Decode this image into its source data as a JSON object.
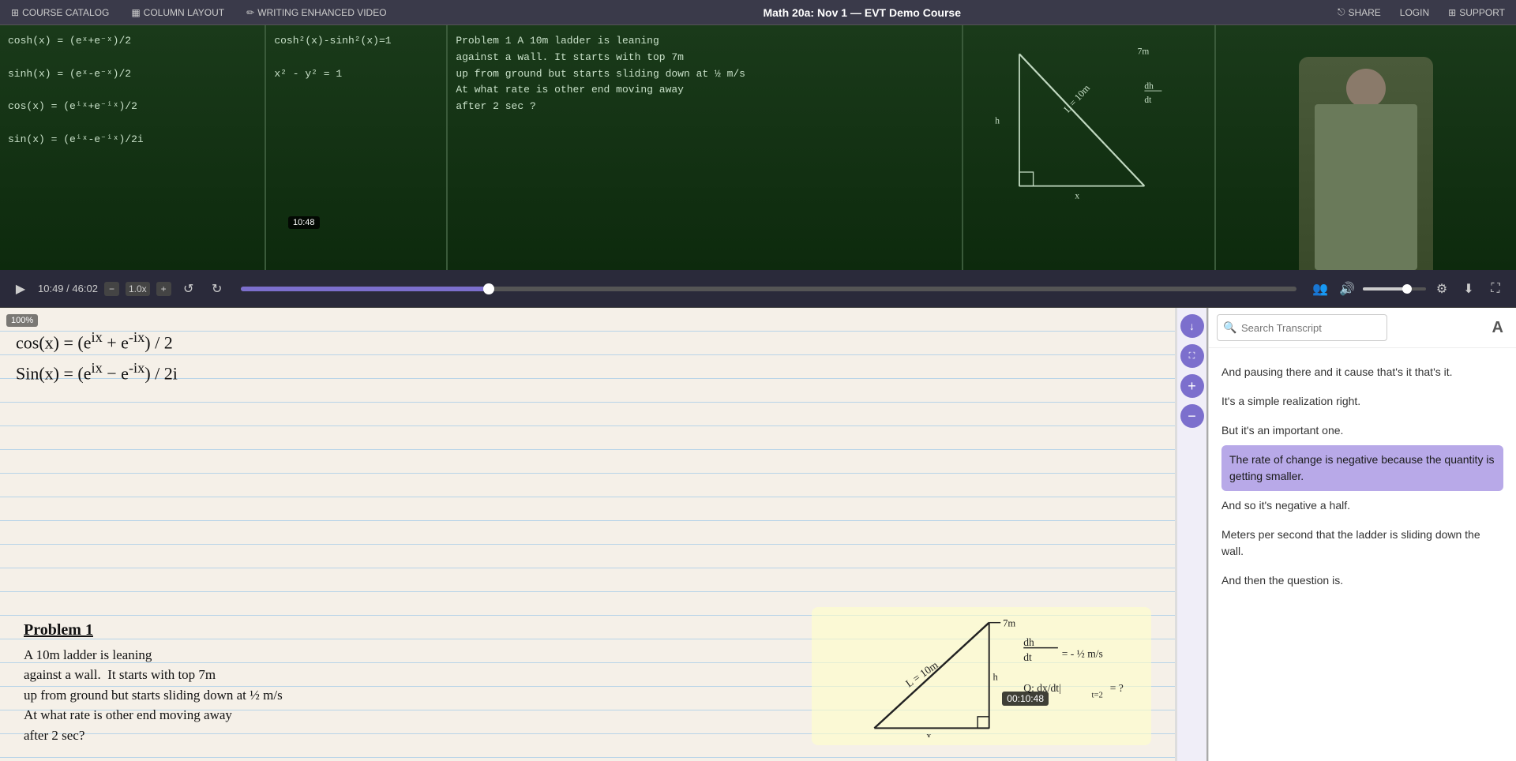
{
  "topNav": {
    "items": [
      {
        "id": "course-catalog",
        "label": "COURSE CATALOG",
        "icon": "grid-icon"
      },
      {
        "id": "column-layout",
        "label": "COLUMN LAYOUT",
        "icon": "columns-icon"
      },
      {
        "id": "writing-enhanced",
        "label": "WRITING ENHANCED VIDEO",
        "icon": "pen-icon"
      }
    ],
    "title": "Math 20a: Nov 1 — EVT Demo Course",
    "rightItems": [
      {
        "id": "share",
        "label": "SHARE",
        "icon": "share-icon"
      },
      {
        "id": "login",
        "label": "LOGIN",
        "icon": null
      },
      {
        "id": "support",
        "label": "SUPPORT",
        "icon": "support-icon"
      }
    ]
  },
  "video": {
    "timeTooltip": "10:48",
    "currentTime": "10:49",
    "totalTime": "46:02",
    "speed": "1.0x",
    "progressPercent": 23.5,
    "volumePercent": 70
  },
  "notebook": {
    "zoom": "100%",
    "formulas": [
      "cos(x) = (e^(ix) + e^(-ix)) / 2",
      "Sin(x) = (e^(ix) - e^(-ix)) / 2i"
    ],
    "problem": {
      "title": "Problem 1",
      "text": "A 10m ladder is leaning\nagainst a wall.  It starts with top 7m\nup from ground but starts sliding down at ½ m/s\nAt what rate is other end moving away\nafter 2 sec?"
    },
    "diagram": {
      "label": "L = 10m",
      "values": [
        "7m",
        "h",
        "x"
      ],
      "equation": "dh/dt = -½ m/s",
      "question": "Q: dx/dt|t=2 = ?"
    }
  },
  "sideControls": {
    "buttons": [
      {
        "id": "download-btn",
        "icon": "↓",
        "label": "download"
      },
      {
        "id": "fullscreen-btn",
        "icon": "⛶",
        "label": "fullscreen"
      },
      {
        "id": "zoom-in-btn",
        "icon": "+",
        "label": "zoom-in"
      },
      {
        "id": "zoom-out-btn",
        "icon": "−",
        "label": "zoom-out"
      }
    ]
  },
  "transcript": {
    "searchPlaceholder": "Search Transcript",
    "lines": [
      {
        "id": 1,
        "text": "And pausing there and it cause that's it that's it.",
        "active": false
      },
      {
        "id": 2,
        "text": "It's a simple realization right.",
        "active": false
      },
      {
        "id": 3,
        "text": "But it's an important one.",
        "active": false
      },
      {
        "id": 4,
        "text": "The rate of change is negative because the quantity is getting smaller.",
        "active": true
      },
      {
        "id": 5,
        "text": "And so it's negative a half.",
        "active": false
      },
      {
        "id": 6,
        "text": "Meters per second that the ladder is sliding down the wall.",
        "active": false
      },
      {
        "id": 7,
        "text": "And then the question is.",
        "active": false
      }
    ]
  },
  "controls": {
    "playIcon": "▶",
    "rewindIcon": "↺",
    "forwardIcon": "↻",
    "peopleIcon": "👥",
    "volumeIcon": "🔊",
    "settingsIcon": "⚙",
    "downloadIcon": "⬇",
    "fullscreenIcon": "⛶",
    "speedMinus": "−",
    "speedLabel": "1.0x",
    "speedPlus": "+"
  }
}
